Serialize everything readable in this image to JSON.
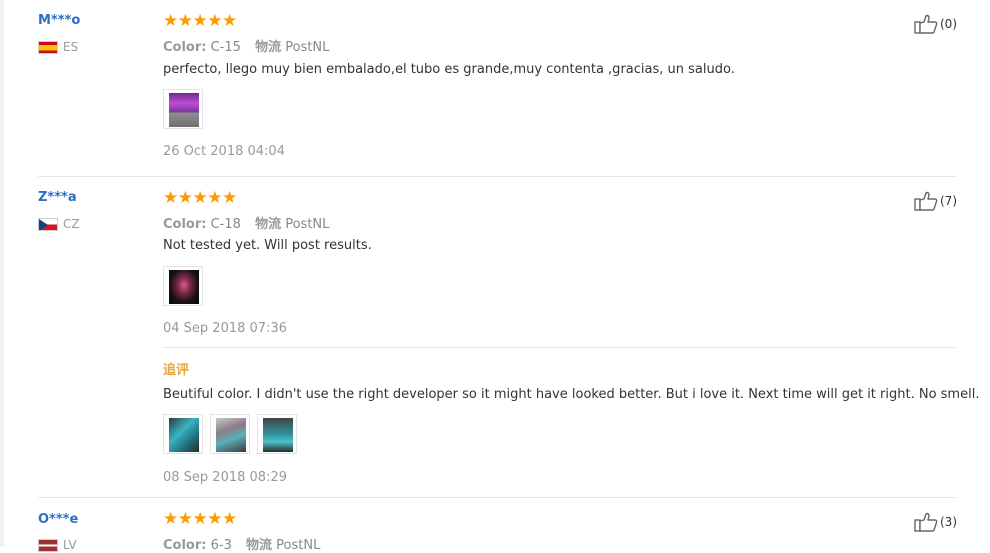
{
  "reviews": [
    {
      "user": "M***o",
      "country": "ES",
      "flag": "spain-flag-icon",
      "rating": 5,
      "stars": "★★★★★",
      "color_label": "Color:",
      "color_value": "C-15",
      "shipping_label": "物流",
      "shipping_value": "PostNL",
      "text": "perfecto, llego muy bien embalado,el tubo es grande,muy contenta ,gracias, un saludo.",
      "date": "26 Oct 2018 04:04",
      "likes": "(0)"
    },
    {
      "user": "Z***a",
      "country": "CZ",
      "flag": "czech-flag-icon",
      "rating": 5,
      "stars": "★★★★★",
      "color_label": "Color:",
      "color_value": "C-18",
      "shipping_label": "物流",
      "shipping_value": "PostNL",
      "text": "Not tested yet. Will post results.",
      "date": "04 Sep 2018 07:36",
      "likes": "(7)",
      "followup": {
        "title": "追评",
        "text": "Beutiful color. I didn't use the right developer so it might have looked better. But i love it. Next time will get it right. No smell.",
        "date": "08 Sep 2018 08:29"
      }
    },
    {
      "user": "O***e",
      "country": "LV",
      "flag": "latvia-flag-icon",
      "rating": 5,
      "stars": "★★★★★",
      "color_label": "Color:",
      "color_value": "6-3",
      "shipping_label": "物流",
      "shipping_value": "PostNL",
      "likes": "(3)"
    }
  ],
  "colors": {
    "username": "#2b6fc2",
    "star": "#ff9900",
    "followup_title": "#e8a53a"
  }
}
